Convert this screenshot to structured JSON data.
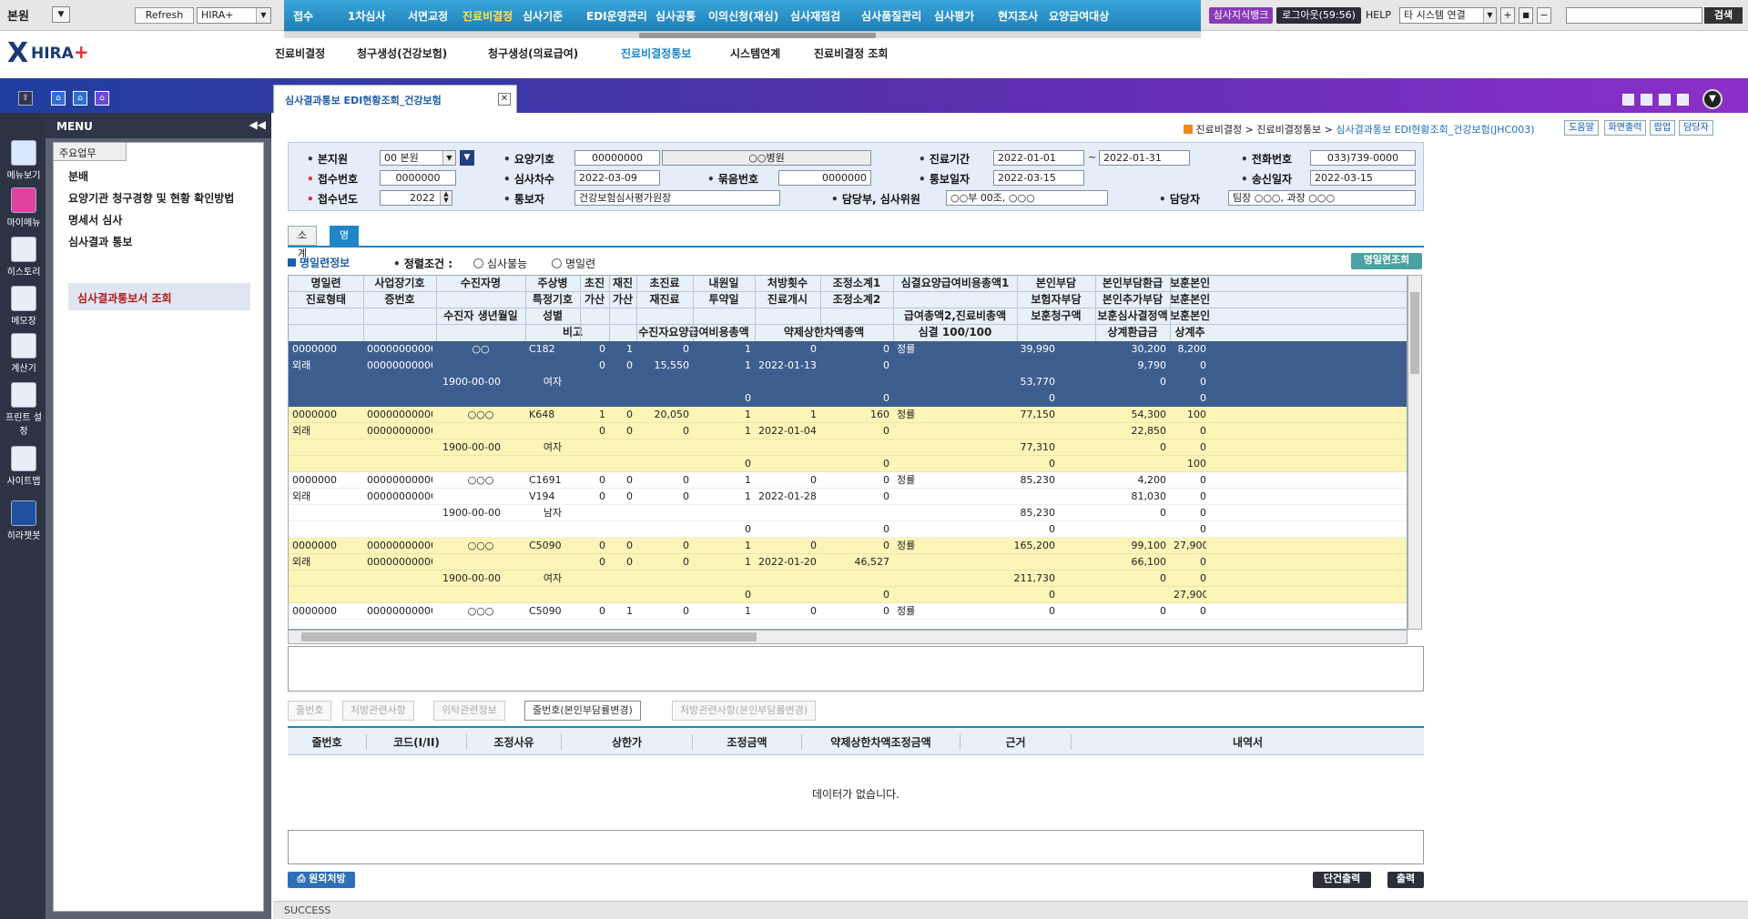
{
  "topbar": {
    "branch": "본원",
    "refresh_label": "Refresh",
    "system_select": "HIRA+",
    "menu": [
      "접수",
      "1차심사",
      "서면교정",
      "진료비결정",
      "심사기준",
      "EDI운영관리",
      "심사공통",
      "이의신청(재심)",
      "심사재점검",
      "심사품질관리",
      "심사평가",
      "현지조사",
      "요양급여대상"
    ],
    "menu_active_index": 3,
    "knowledge_bank": "심사지식뱅크",
    "logout": "로그아웃(59:56)",
    "help": "HELP",
    "other_system": "타 시스템 연결",
    "plus": "+",
    "square": "■",
    "minus": "−",
    "search_button": "검색"
  },
  "header": {
    "logo": "HIRA",
    "logo_plus": "+",
    "subnav": [
      "진료비결정",
      "청구생성(건강보험)",
      "청구생성(의료급여)",
      "진료비결정통보",
      "시스템연계",
      "진료비결정 조회"
    ],
    "subnav_active_index": 3,
    "open_tab": "심사결과통보 EDI현황조회_건강보험",
    "close_x": "✕"
  },
  "iconbar": [
    "메뉴보기",
    "마이메뉴",
    "히스토리",
    "메모장",
    "계산기",
    "프린트 설정",
    "사이트맵",
    "히라챗봇"
  ],
  "sidebar": {
    "title": "MENU",
    "collapse": "◀◀",
    "tab": "주요업무",
    "items": [
      "분배",
      "요양기관 청구경향 및 현황 확인방법",
      "명세서 심사",
      "심사결과 통보"
    ],
    "selected": "심사결과통보서 조회"
  },
  "breadcrumb": {
    "parts": [
      "진료비결정",
      "진료비결정통보"
    ],
    "sep": ">",
    "current": "심사결과통보 EDI현황조회_건강보험(JHC003)",
    "buttons": [
      "도움말",
      "화면출력",
      "팝업",
      "담당자"
    ]
  },
  "filter": {
    "labels": {
      "branch": "본지원",
      "institution": "요양기호",
      "period": "진료기간",
      "phone": "전화번호",
      "receipt_no": "접수번호",
      "review_seq": "심사차수",
      "bundle_no": "묶음번호",
      "notice_date": "통보일자",
      "send_date": "송신일자",
      "receipt_year": "접수년도",
      "notifier": "통보자",
      "dept": "담당부, 심사위원",
      "manager": "담당자"
    },
    "values": {
      "branch": "00 본원",
      "institution_code": "00000000",
      "institution_name": "○○병원",
      "period_from": "2022-01-01",
      "period_sep": "~",
      "period_to": "2022-01-31",
      "phone": "033)739-0000",
      "receipt_no": "0000000",
      "review_seq": "2022-03-09",
      "bundle_no": "0000000",
      "notice_date": "2022-03-15",
      "send_date": "2022-03-15",
      "receipt_year": "2022",
      "notifier": "건강보험심사평가원장",
      "dept": "○○부 00조, ○○○",
      "manager": "팀장 ○○○, 과장 ○○○"
    }
  },
  "tabs": [
    "소계",
    "명일련정보"
  ],
  "tabs_active_index": 1,
  "section": {
    "title": "명일련정보",
    "sort_label": "정렬조건 :",
    "sort_options": [
      "심사불능",
      "명일련"
    ],
    "lookup_button": "명일련조회"
  },
  "grid": {
    "header_rows": [
      [
        "명일련",
        "사업장기호",
        "수진자명",
        "주상병",
        "초진",
        "재진",
        "초진료",
        "내원일",
        "처방횟수",
        "조정소계1",
        "심결요양급여비용총액1",
        "본인부담",
        "본인부담환급",
        "보훈본인"
      ],
      [
        "진료형태",
        "증번호",
        "",
        "특정기호",
        "가산",
        "가산",
        "재진료",
        "투약일",
        "진료개시",
        "조정소계2",
        "",
        "보험자부담",
        "본인추가부담",
        "보훈본인"
      ],
      [
        "",
        "",
        "수진자 생년월일",
        "성별",
        "",
        "",
        "",
        "",
        "",
        "",
        "급여총액2,진료비총액",
        "보훈청구액",
        "보훈심사결정액",
        "보훈본인"
      ],
      [
        "",
        "",
        "비고",
        "",
        "",
        "",
        "수진자요양급여비용총액",
        "",
        "약제상한차액총액",
        "",
        "심결 100/100",
        "",
        "상계환급금",
        "상계추"
      ]
    ],
    "records": [
      {
        "bg": "#3e5e90",
        "fg": "#ffffff",
        "rows": [
          [
            "0000000",
            "00000000000",
            "○○",
            "C182",
            "0",
            "1",
            "0",
            "1",
            "0",
            "0",
            "정률",
            "39,990",
            "30,200",
            "8,200"
          ],
          [
            "외래",
            "00000000000",
            "",
            "",
            "0",
            "0",
            "15,550",
            "1",
            "2022-01-13",
            "0",
            "",
            "",
            "9,790",
            "0"
          ],
          [
            "",
            "",
            "1900-00-00",
            "여자",
            "",
            "",
            "",
            "",
            "",
            "",
            "",
            "53,770",
            "0",
            "0"
          ],
          [
            "",
            "",
            "",
            "",
            "",
            "",
            "",
            "0",
            "",
            "0",
            "",
            "0",
            "",
            "0"
          ]
        ]
      },
      {
        "bg": "#fbf5b7",
        "fg": "#222222",
        "rows": [
          [
            "0000000",
            "00000000000",
            "○○○",
            "K648",
            "1",
            "0",
            "20,050",
            "1",
            "1",
            "160",
            "정률",
            "77,150",
            "54,300",
            "100"
          ],
          [
            "외래",
            "00000000000",
            "",
            "",
            "0",
            "0",
            "0",
            "1",
            "2022-01-04",
            "0",
            "",
            "",
            "22,850",
            "0"
          ],
          [
            "",
            "",
            "1900-00-00",
            "여자",
            "",
            "",
            "",
            "",
            "",
            "",
            "",
            "77,310",
            "0",
            "0"
          ],
          [
            "",
            "",
            "",
            "",
            "",
            "",
            "",
            "0",
            "",
            "0",
            "",
            "0",
            "",
            "100"
          ]
        ]
      },
      {
        "bg": "#ffffff",
        "fg": "#222222",
        "rows": [
          [
            "0000000",
            "00000000000",
            "○○○",
            "C1691",
            "0",
            "0",
            "0",
            "1",
            "0",
            "0",
            "정률",
            "85,230",
            "4,200",
            "0"
          ],
          [
            "외래",
            "00000000000",
            "",
            "V194",
            "0",
            "0",
            "0",
            "1",
            "2022-01-28",
            "0",
            "",
            "",
            "81,030",
            "0"
          ],
          [
            "",
            "",
            "1900-00-00",
            "남자",
            "",
            "",
            "",
            "",
            "",
            "",
            "",
            "85,230",
            "0",
            "0"
          ],
          [
            "",
            "",
            "",
            "",
            "",
            "",
            "",
            "0",
            "",
            "0",
            "",
            "0",
            "",
            "0"
          ]
        ]
      },
      {
        "bg": "#fbf5b7",
        "fg": "#222222",
        "rows": [
          [
            "0000000",
            "00000000000",
            "○○○",
            "C5090",
            "0",
            "0",
            "0",
            "1",
            "0",
            "0",
            "정률",
            "165,200",
            "99,100",
            "27,900"
          ],
          [
            "외래",
            "00000000000",
            "",
            "",
            "0",
            "0",
            "0",
            "1",
            "2022-01-20",
            "46,527",
            "",
            "",
            "66,100",
            "0"
          ],
          [
            "",
            "",
            "1900-00-00",
            "여자",
            "",
            "",
            "",
            "",
            "",
            "",
            "",
            "211,730",
            "0",
            "0"
          ],
          [
            "",
            "",
            "",
            "",
            "",
            "",
            "",
            "0",
            "",
            "0",
            "",
            "0",
            "",
            "27,900"
          ]
        ]
      },
      {
        "bg": "#ffffff",
        "fg": "#222222",
        "rows": [
          [
            "0000000",
            "00000000000",
            "○○○",
            "C5090",
            "0",
            "1",
            "0",
            "1",
            "0",
            "0",
            "정률",
            "0",
            "0",
            "0"
          ]
        ]
      }
    ]
  },
  "detail_tabs": [
    "줄번호",
    "처방관련사항",
    "위탁관련정보",
    "줄번호(본인부담률변경)",
    "처방관련사항(본인부담률변경)"
  ],
  "detail_tabs_active_index": 3,
  "detail_grid": {
    "headers": [
      "줄번호",
      "코드(I/II)",
      "조정사유",
      "상한가",
      "조정금액",
      "약제상한차액조정금액",
      "근거",
      "내역서"
    ],
    "empty_text": "데이터가 없습니다."
  },
  "bottom": {
    "left_button": "원외처방",
    "print_single": "단건출력",
    "print": "출력"
  },
  "status": "SUCCESS"
}
